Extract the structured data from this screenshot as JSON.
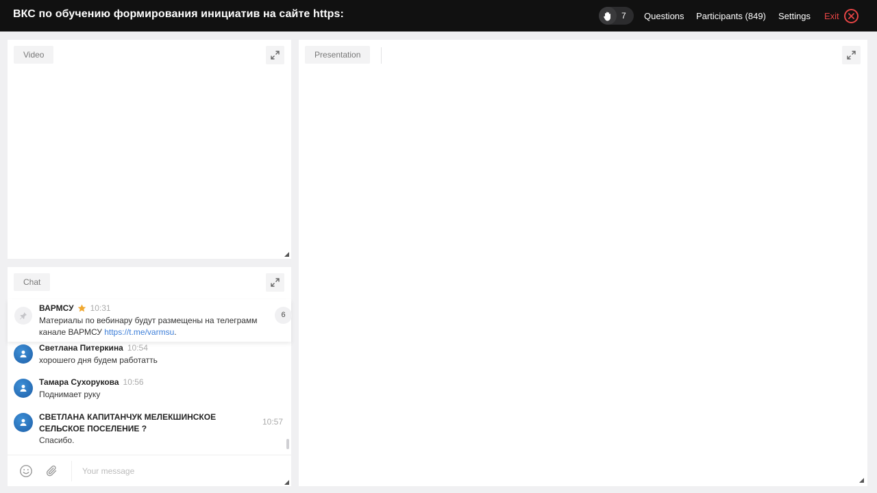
{
  "topbar": {
    "title": "ВКС по обучению формирования инициатив на сайте https:",
    "raised_hands": "7",
    "questions_label": "Questions",
    "participants_label": "Participants (849)",
    "settings_label": "Settings",
    "exit_label": "Exit",
    "exit_color": "#e84545"
  },
  "video_panel": {
    "tag": "Video"
  },
  "presentation_panel": {
    "tag": "Presentation"
  },
  "chat": {
    "tag": "Chat",
    "pinned": {
      "author": "ВАРМСУ",
      "time": "10:31",
      "text_line1": "Материалы по вебинару будут размещены на телеграмм",
      "text_line2": "канале ВАРМСУ",
      "link": "https://t.me/varmsu",
      "badge": "6"
    },
    "messages": [
      {
        "author": "Светлана Питеркина",
        "time": "10:54",
        "text": "хорошего дня будем работатть"
      },
      {
        "author": "Тамара Сухорукова",
        "time": "10:56",
        "text": "Поднимает руку"
      },
      {
        "author_line1": "СВЕТЛАНА КАПИТАНЧУК МЕЛЕКШИНСКОЕ",
        "author_line2": "СЕЛЬСКОЕ ПОСЕЛЕНИЕ ?",
        "time": "10:57",
        "text": "Спасибо."
      }
    ],
    "composer_placeholder": "Your message"
  },
  "icons": {
    "hand": "raised-hand-icon",
    "exit": "close-circle-icon",
    "expand": "expand-icon",
    "pin": "pin-icon",
    "avatar": "user-icon",
    "emoji": "emoji-icon",
    "attach": "paperclip-icon"
  },
  "colors": {
    "topbar_bg": "#111111",
    "avatar_blue": "#2a72c0",
    "link_blue": "#3b7dd8",
    "star": "#f0a830"
  }
}
